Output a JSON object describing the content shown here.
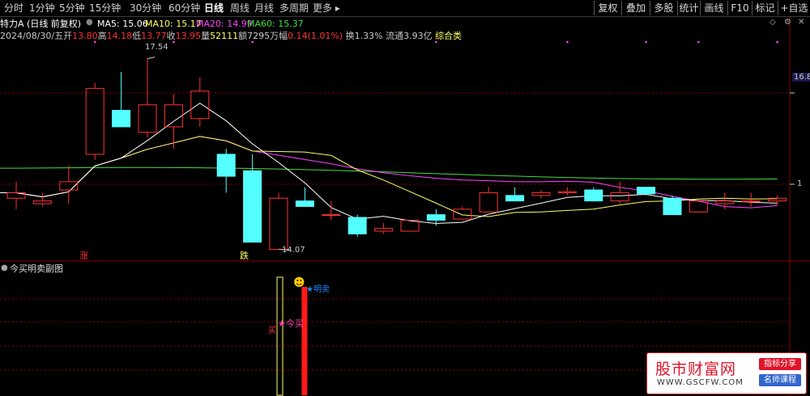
{
  "period_tabs": [
    "分时",
    "1分钟",
    "5分钟",
    "15分钟",
    "30分钟",
    "60分钟",
    "日线",
    "周线",
    "月线",
    "多周期",
    "更多"
  ],
  "active_period": "日线",
  "toolbar": [
    "复权",
    "叠加",
    "多股",
    "统计",
    "画线",
    "F10",
    "标记",
    "+自选"
  ],
  "stock_title": "特力A (日线 前复权)",
  "ma": [
    {
      "label": "MA5: 15.06",
      "color": "#ffffff"
    },
    {
      "label": "MA10: 15.17",
      "color": "#ffff66"
    },
    {
      "label": "MA20: 14.99",
      "color": "#ff44ff"
    },
    {
      "label": "MA60: 15.37",
      "color": "#44dd44"
    }
  ],
  "quote": {
    "date": "2024/08/30/五",
    "open_label": "开",
    "open": "13.80",
    "high_label": "高",
    "high": "14.18",
    "low_label": "低",
    "low": "13.77",
    "close_label": "收",
    "close": "13.95",
    "vol_label": "量",
    "vol": "52111",
    "amount_label": "额",
    "amount": "7295万",
    "change_label": "幅",
    "change": "0.14(1.01%)",
    "turnover": "换1.33%",
    "float_cap": "流通3.93亿",
    "category": "综合类"
  },
  "annotations": {
    "high_price": "17.54",
    "low_price": "14.07",
    "rise_mark": "涨",
    "fall_mark": "跌"
  },
  "right_axis": {
    "upper": "16.8",
    "lower": "1"
  },
  "sub_panel": {
    "title": "今买明卖副图",
    "buy_label": "★今买",
    "sell_label": "★明卖",
    "side_char": "买"
  },
  "colors": {
    "up": "#ff3232",
    "down": "#54ffff",
    "background": "#000000",
    "grid": "#8b0000"
  },
  "chart_data": {
    "type": "candlestick",
    "candles": [
      {
        "o": 15.0,
        "h": 15.3,
        "l": 14.8,
        "c": 15.1
      },
      {
        "o": 14.9,
        "h": 15.1,
        "l": 14.85,
        "c": 14.95
      },
      {
        "o": 15.15,
        "h": 15.6,
        "l": 14.9,
        "c": 15.3
      },
      {
        "o": 15.8,
        "h": 17.1,
        "l": 15.7,
        "c": 17.0
      },
      {
        "o": 16.6,
        "h": 17.3,
        "l": 16.3,
        "c": 16.3
      },
      {
        "o": 16.2,
        "h": 17.54,
        "l": 16.1,
        "c": 16.7
      },
      {
        "o": 16.3,
        "h": 16.9,
        "l": 15.9,
        "c": 16.7
      },
      {
        "o": 16.45,
        "h": 17.2,
        "l": 16.3,
        "c": 16.95
      },
      {
        "o": 15.8,
        "h": 15.9,
        "l": 15.1,
        "c": 15.4
      },
      {
        "o": 15.5,
        "h": 15.8,
        "l": 14.2,
        "c": 14.2
      },
      {
        "o": 14.07,
        "h": 15.1,
        "l": 14.07,
        "c": 15.0
      },
      {
        "o": 14.95,
        "h": 15.2,
        "l": 14.85,
        "c": 14.85
      },
      {
        "o": 14.7,
        "h": 14.95,
        "l": 14.6,
        "c": 14.7
      },
      {
        "o": 14.65,
        "h": 14.7,
        "l": 14.3,
        "c": 14.35
      },
      {
        "o": 14.4,
        "h": 14.55,
        "l": 14.35,
        "c": 14.45
      },
      {
        "o": 14.4,
        "h": 14.6,
        "l": 14.4,
        "c": 14.6
      },
      {
        "o": 14.7,
        "h": 14.8,
        "l": 14.5,
        "c": 14.6
      },
      {
        "o": 14.62,
        "h": 14.85,
        "l": 14.62,
        "c": 14.8
      },
      {
        "o": 14.75,
        "h": 15.2,
        "l": 14.75,
        "c": 15.1
      },
      {
        "o": 15.05,
        "h": 15.2,
        "l": 14.95,
        "c": 14.95
      },
      {
        "o": 15.05,
        "h": 15.15,
        "l": 15.0,
        "c": 15.1
      },
      {
        "o": 15.1,
        "h": 15.2,
        "l": 15.05,
        "c": 15.12
      },
      {
        "o": 15.15,
        "h": 15.2,
        "l": 14.95,
        "c": 14.95
      },
      {
        "o": 14.95,
        "h": 15.3,
        "l": 14.9,
        "c": 15.1
      },
      {
        "o": 15.2,
        "h": 15.2,
        "l": 15.05,
        "c": 15.08
      },
      {
        "o": 15.0,
        "h": 15.05,
        "l": 14.7,
        "c": 14.7
      },
      {
        "o": 14.75,
        "h": 14.95,
        "l": 14.75,
        "c": 14.95
      },
      {
        "o": 14.9,
        "h": 15.1,
        "l": 14.8,
        "c": 14.95
      },
      {
        "o": 14.95,
        "h": 15.1,
        "l": 14.85,
        "c": 14.95
      },
      {
        "o": 14.95,
        "h": 15.05,
        "l": 14.88,
        "c": 15.0
      }
    ],
    "ylim": [
      13.9,
      17.8
    ],
    "buy_signal_bar": 10,
    "sell_signal_bar": 11
  }
}
